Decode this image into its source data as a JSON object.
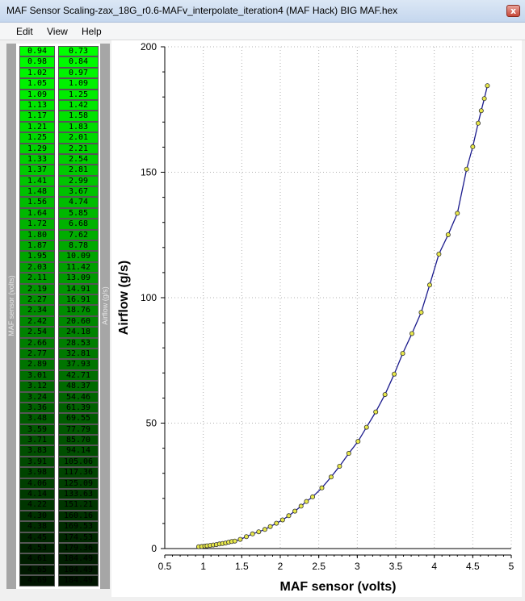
{
  "window": {
    "title": "MAF Sensor Scaling-zax_18G_r0.6-MAFv_interpolate_iteration4 (MAF Hack) BIG MAF.hex",
    "close_glyph": "x"
  },
  "menu": {
    "edit": "Edit",
    "view": "View",
    "help": "Help"
  },
  "table": {
    "voltage_label": "MAF sensor (volts)",
    "airflow_label": "Airflow (g/s)",
    "voltage_values": [
      "0.94",
      "0.98",
      "1.02",
      "1.05",
      "1.09",
      "1.13",
      "1.17",
      "1.21",
      "1.25",
      "1.29",
      "1.33",
      "1.37",
      "1.41",
      "1.48",
      "1.56",
      "1.64",
      "1.72",
      "1.80",
      "1.87",
      "1.95",
      "2.03",
      "2.11",
      "2.19",
      "2.27",
      "2.34",
      "2.42",
      "2.54",
      "2.66",
      "2.77",
      "2.89",
      "3.01",
      "3.12",
      "3.24",
      "3.36",
      "3.48",
      "3.59",
      "3.71",
      "3.83",
      "3.91",
      "3.98",
      "4.06",
      "4.14",
      "4.22",
      "4.30",
      "4.38",
      "4.45",
      "4.53",
      "4.61",
      "4.65",
      "4.69"
    ],
    "airflow_values": [
      "0.73",
      "0.84",
      "0.97",
      "1.09",
      "1.25",
      "1.42",
      "1.58",
      "1.83",
      "2.01",
      "2.21",
      "2.54",
      "2.81",
      "2.99",
      "3.67",
      "4.74",
      "5.85",
      "6.68",
      "7.62",
      "8.78",
      "10.09",
      "11.42",
      "13.09",
      "14.91",
      "16.91",
      "18.76",
      "20.60",
      "24.18",
      "28.53",
      "32.81",
      "37.93",
      "42.71",
      "48.37",
      "54.46",
      "61.39",
      "69.55",
      "77.79",
      "85.70",
      "94.14",
      "105.06",
      "117.36",
      "125.09",
      "133.63",
      "151.21",
      "160.16",
      "169.53",
      "174.53",
      "179.36",
      "184.49",
      "184.49",
      "184.49"
    ]
  },
  "colors": {
    "cell_bright": "#00ff00",
    "cell_dark": "#001a00",
    "line": "#1a1a8c",
    "marker_fill": "#e8e84a",
    "marker_stroke": "#333333",
    "grid": "#b0b0b0"
  },
  "chart_data": {
    "type": "line",
    "xlabel": "MAF sensor (volts)",
    "ylabel": "Airflow (g/s)",
    "xlim": [
      0.5,
      5
    ],
    "ylim": [
      0,
      200
    ],
    "xticks": [
      "0.5",
      "1",
      "1.5",
      "2",
      "2.5",
      "3",
      "3.5",
      "4",
      "4.5",
      "5"
    ],
    "yticks": [
      "0",
      "50",
      "100",
      "150",
      "200"
    ],
    "grid": true,
    "series": [
      {
        "x": [
          0.94,
          0.98,
          1.02,
          1.05,
          1.09,
          1.13,
          1.17,
          1.21,
          1.25,
          1.29,
          1.33,
          1.37,
          1.41,
          1.48,
          1.56,
          1.64,
          1.72,
          1.8,
          1.87,
          1.95,
          2.03,
          2.11,
          2.19,
          2.27,
          2.34,
          2.42,
          2.54,
          2.66,
          2.77,
          2.89,
          3.01,
          3.12,
          3.24,
          3.36,
          3.48,
          3.59,
          3.71,
          3.83,
          3.94,
          4.06,
          4.18,
          4.3,
          4.42,
          4.5,
          4.57,
          4.61,
          4.65,
          4.69
        ],
        "y": [
          0.73,
          0.84,
          0.97,
          1.09,
          1.25,
          1.42,
          1.58,
          1.83,
          2.01,
          2.21,
          2.54,
          2.81,
          2.99,
          3.67,
          4.74,
          5.85,
          6.68,
          7.62,
          8.78,
          10.09,
          11.42,
          13.09,
          14.91,
          16.91,
          18.76,
          20.6,
          24.18,
          28.53,
          32.81,
          37.93,
          42.71,
          48.37,
          54.46,
          61.39,
          69.55,
          77.79,
          85.7,
          94.14,
          105.06,
          117.36,
          125.09,
          133.63,
          151.21,
          160.16,
          169.53,
          174.53,
          179.36,
          184.49
        ]
      }
    ]
  }
}
